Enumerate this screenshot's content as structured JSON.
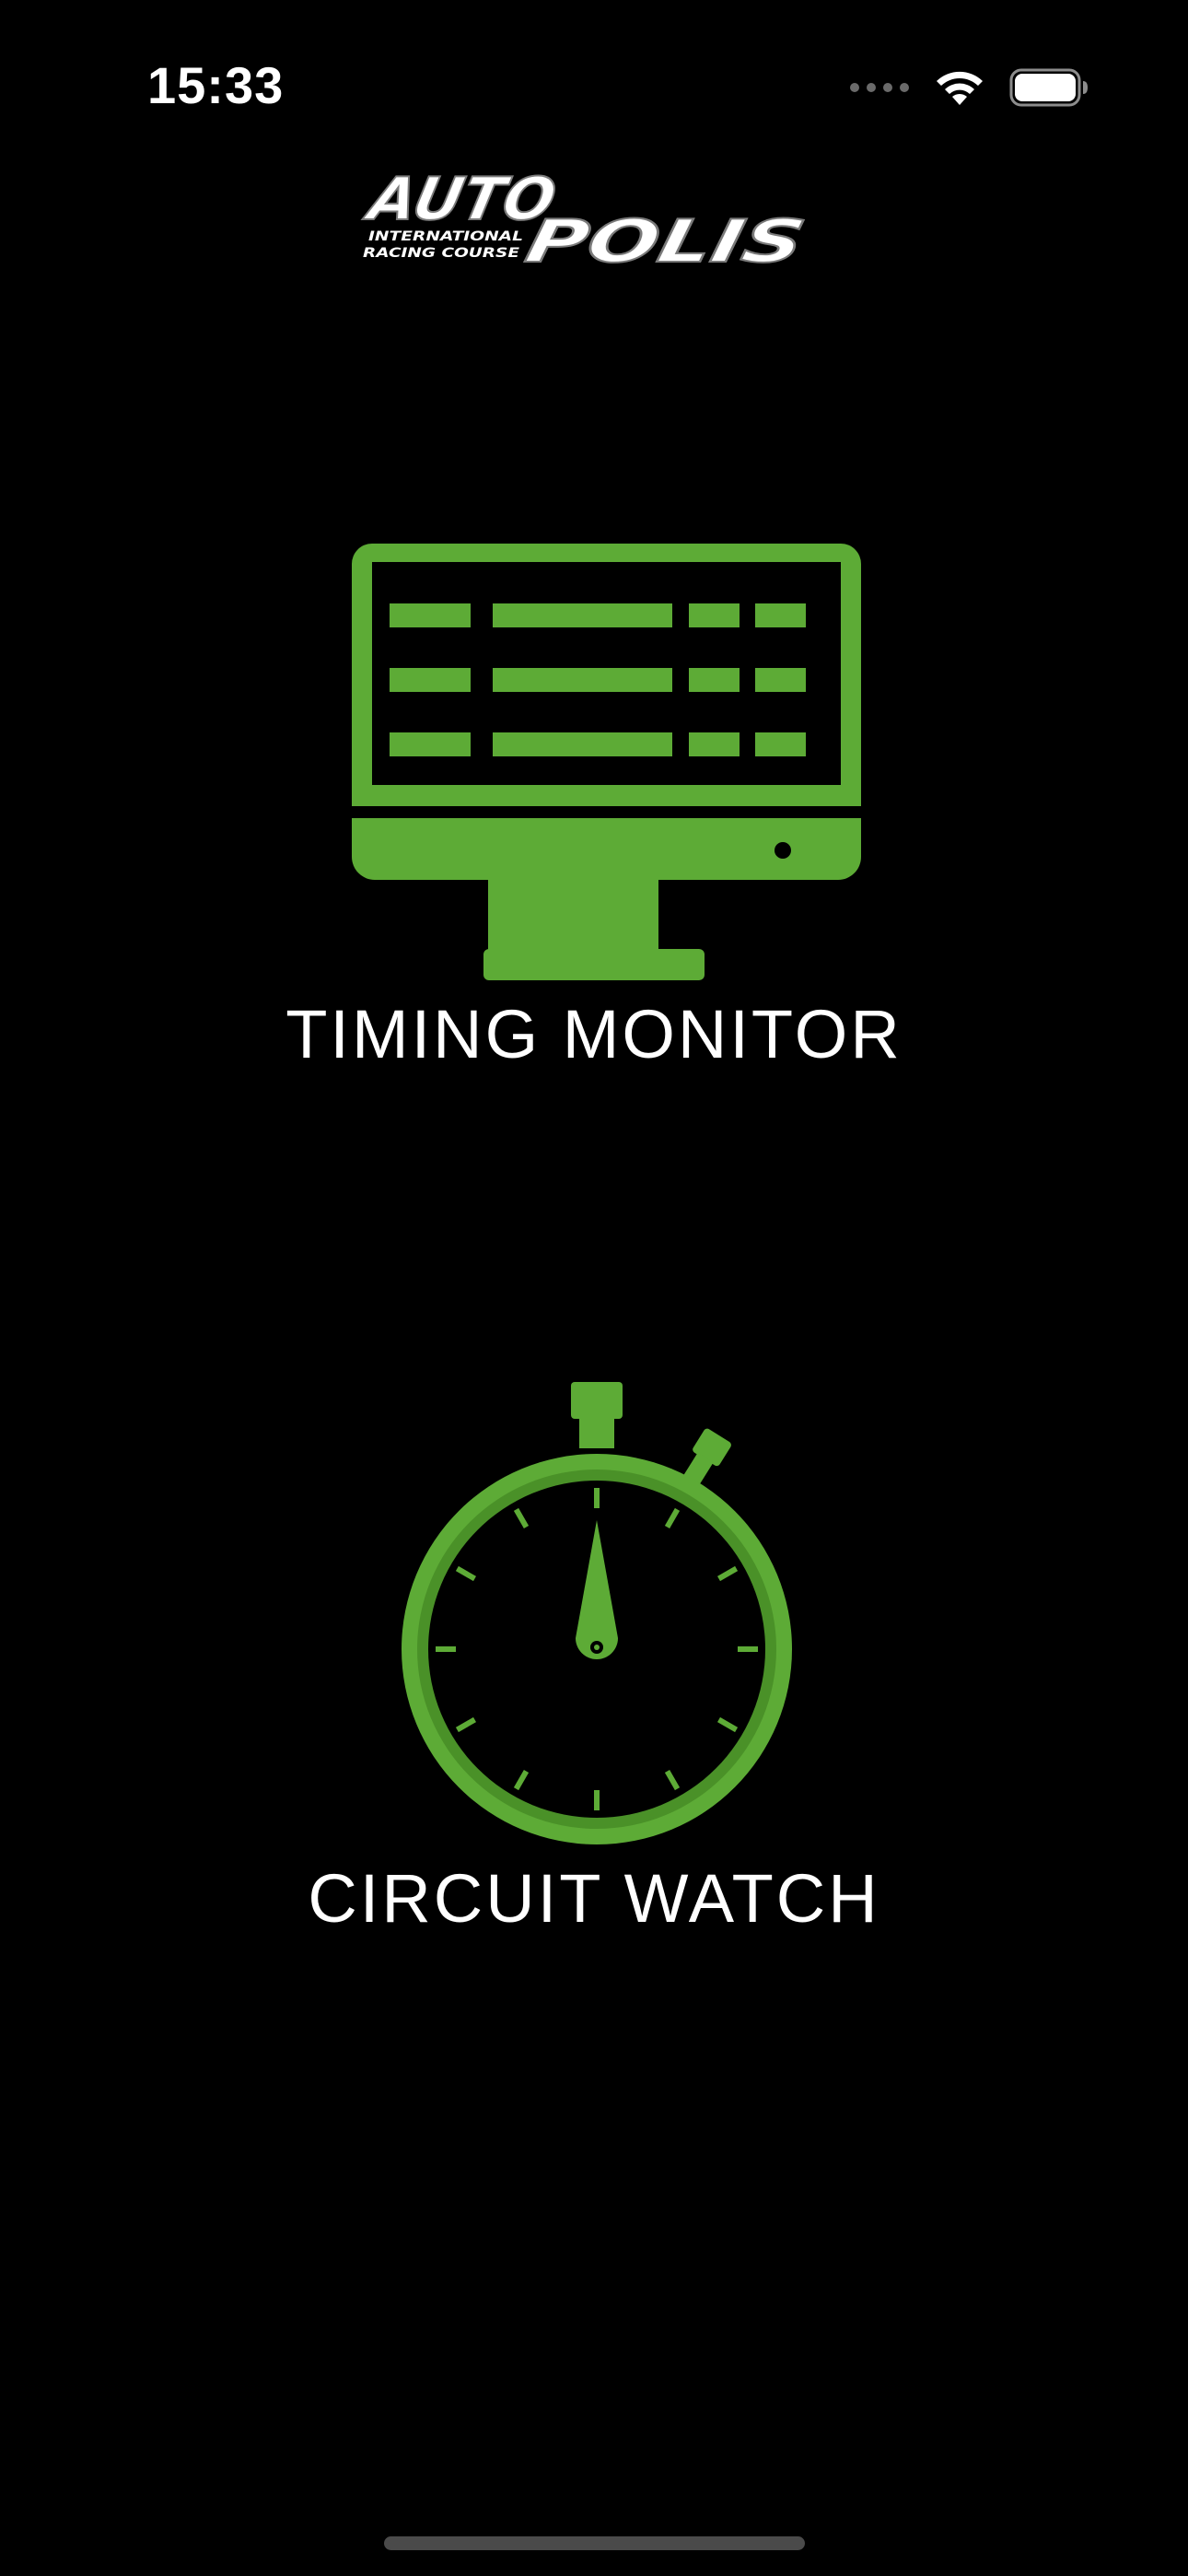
{
  "status_bar": {
    "time": "15:33"
  },
  "logo": {
    "brand_text_top": "AUTO",
    "brand_text_bottom": "POLIS",
    "subtitle_line1": "INTERNATIONAL",
    "subtitle_line2": "RACING COURSE"
  },
  "menu": {
    "items": [
      {
        "label": "TIMING MONITOR",
        "icon": "monitor-icon"
      },
      {
        "label": "CIRCUIT WATCH",
        "icon": "stopwatch-icon"
      }
    ]
  },
  "colors": {
    "background": "#000000",
    "accent_green": "#5dab36",
    "text": "#ffffff"
  }
}
